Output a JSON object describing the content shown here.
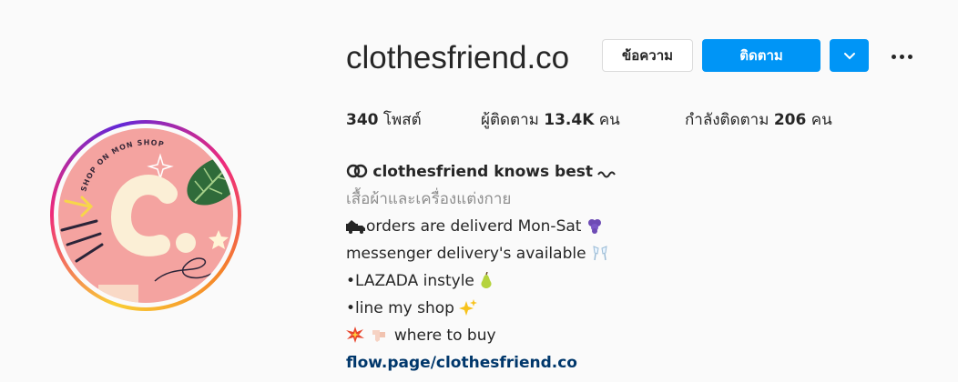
{
  "profile": {
    "username": "clothesfriend.co",
    "avatar_letter": "C.",
    "avatar_ring_text": "SHOP ON MON SHOP"
  },
  "actions": {
    "message_label": "ข้อความ",
    "follow_label": "ติดตาม"
  },
  "stats": {
    "posts": "340",
    "posts_label": "โพสต์",
    "followers_label": "ผู้ติดตาม",
    "followers": "13.4K",
    "followers_unit": "คน",
    "following_label": "กำลังติดตาม",
    "following": "206",
    "following_unit": "คน"
  },
  "bio": {
    "name": "clothesfriend knows best",
    "category": "เสื้อผ้าและเครื่องแต่งกาย",
    "lines": [
      "orders are deliverd Mon-Sat",
      "messenger delivery's available",
      "•LAZADA instyle",
      "•line my shop",
      "where to buy"
    ],
    "link": "flow.page/clothesfriend.co"
  },
  "colors": {
    "accent": "#0095f6",
    "link": "#00376b",
    "muted": "#8e8e8e",
    "avatar_bg": "#f4a3a0"
  }
}
